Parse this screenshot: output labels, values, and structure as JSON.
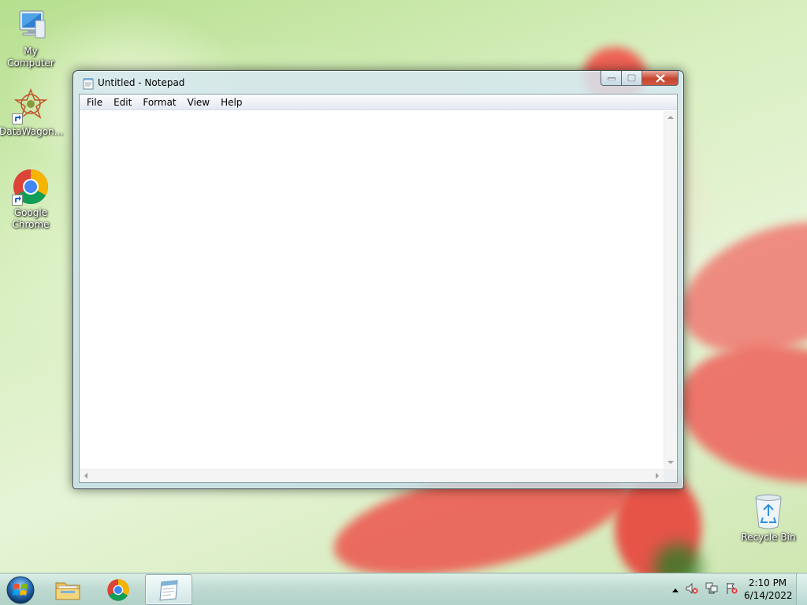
{
  "desktop": {
    "icons": [
      {
        "label": "My Computer",
        "icon": "computer-icon"
      },
      {
        "label": "DataWagon...",
        "icon": "datawagon-icon"
      },
      {
        "label": "Google Chrome",
        "icon": "chrome-icon"
      },
      {
        "label": "Recycle Bin",
        "icon": "recycle-bin-icon"
      }
    ]
  },
  "window": {
    "title": "Untitled - Notepad",
    "menu": [
      "File",
      "Edit",
      "Format",
      "View",
      "Help"
    ],
    "content": ""
  },
  "taskbar": {
    "pinned": [
      {
        "name": "explorer",
        "icon": "folder-icon"
      },
      {
        "name": "chrome",
        "icon": "chrome-icon"
      },
      {
        "name": "notepad",
        "icon": "notepad-icon",
        "active": true
      }
    ],
    "clock": {
      "time": "2:10 PM",
      "date": "6/14/2022"
    }
  },
  "colors": {
    "accent": "#3d4d55",
    "close": "#c7442e"
  }
}
